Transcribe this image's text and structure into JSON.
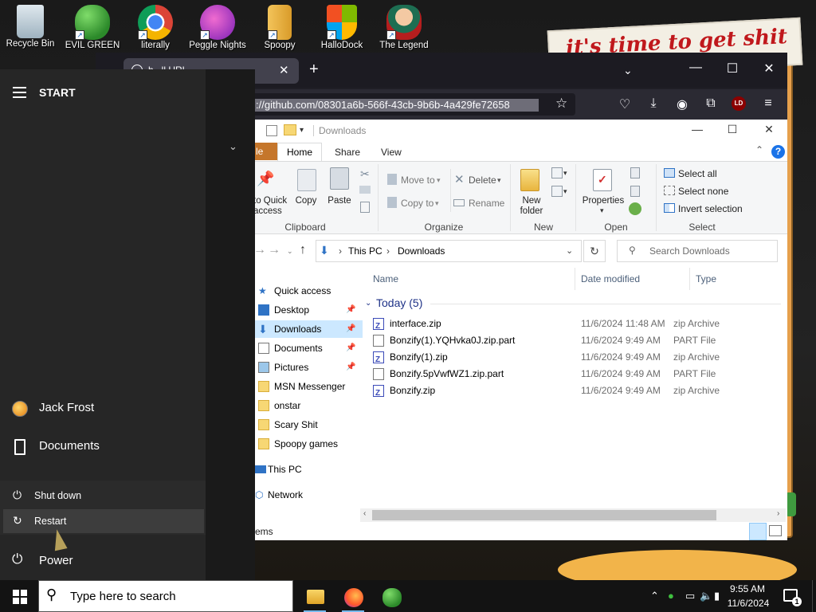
{
  "desktop": {
    "icons": [
      {
        "label": "Recycle Bin"
      },
      {
        "label": "EVIL GREEN"
      },
      {
        "label": "literally"
      },
      {
        "label": "Peggle Nights"
      },
      {
        "label": "Spoopy"
      },
      {
        "label": "HalloDock"
      },
      {
        "label": "The Legend"
      }
    ],
    "wallpaper_text": "it's time to get shit"
  },
  "browser": {
    "tab_title": "h...ll URL",
    "url_selected": "://github.com/08301a6b-566f-43cb-9b6b-4a429fe72658",
    "ublock_badge": "LD"
  },
  "explorer": {
    "title": "Downloads",
    "ribbon_tabs": {
      "file": "le",
      "home": "Home",
      "share": "Share",
      "view": "View"
    },
    "ribbon": {
      "clipboard": {
        "pin": "to Quick\naccess",
        "copy": "Copy",
        "paste": "Paste",
        "label": "Clipboard"
      },
      "organize": {
        "move_to": "Move to",
        "copy_to": "Copy to",
        "delete": "Delete",
        "rename": "Rename",
        "label": "Organize"
      },
      "new": {
        "new_folder": "New\nfolder",
        "label": "New"
      },
      "open": {
        "properties": "Properties",
        "label": "Open"
      },
      "select": {
        "select_all": "Select all",
        "select_none": "Select none",
        "invert": "Invert selection",
        "label": "Select"
      }
    },
    "breadcrumb": {
      "root": "This PC",
      "current": "Downloads"
    },
    "search_placeholder": "Search Downloads",
    "nav": {
      "quick_access": "Quick access",
      "pinned": [
        {
          "label": "Desktop",
          "pinned": true
        },
        {
          "label": "Downloads",
          "pinned": true,
          "selected": true
        },
        {
          "label": "Documents",
          "pinned": true
        },
        {
          "label": "Pictures",
          "pinned": true
        },
        {
          "label": "MSN Messenger"
        },
        {
          "label": "onstar"
        },
        {
          "label": "Scary Shit"
        },
        {
          "label": "Spoopy games"
        }
      ],
      "this_pc": "This PC",
      "network": "Network"
    },
    "columns": {
      "name": "Name",
      "date": "Date modified",
      "type": "Type"
    },
    "group": "Today (5)",
    "files": [
      {
        "name": "interface.zip",
        "date": "11/6/2024 11:48 AM",
        "type": "zip Archive",
        "kind": "zip"
      },
      {
        "name": "Bonzify(1).YQHvka0J.zip.part",
        "date": "11/6/2024 9:49 AM",
        "type": "PART File",
        "kind": "part"
      },
      {
        "name": "Bonzify(1).zip",
        "date": "11/6/2024 9:49 AM",
        "type": "zip Archive",
        "kind": "zip"
      },
      {
        "name": "Bonzify.5pVwfWZ1.zip.part",
        "date": "11/6/2024 9:49 AM",
        "type": "PART File",
        "kind": "part"
      },
      {
        "name": "Bonzify.zip",
        "date": "11/6/2024 9:49 AM",
        "type": "zip Archive",
        "kind": "zip"
      }
    ],
    "status": "ems"
  },
  "start_menu": {
    "title": "START",
    "user": "Jack Frost",
    "documents": "Documents",
    "power": "Power",
    "power_options": {
      "shutdown": "Shut down",
      "restart": "Restart"
    }
  },
  "taskbar": {
    "search_placeholder": "Type here to search",
    "time": "9:55 AM",
    "date": "11/6/2024",
    "notifications": "1"
  }
}
